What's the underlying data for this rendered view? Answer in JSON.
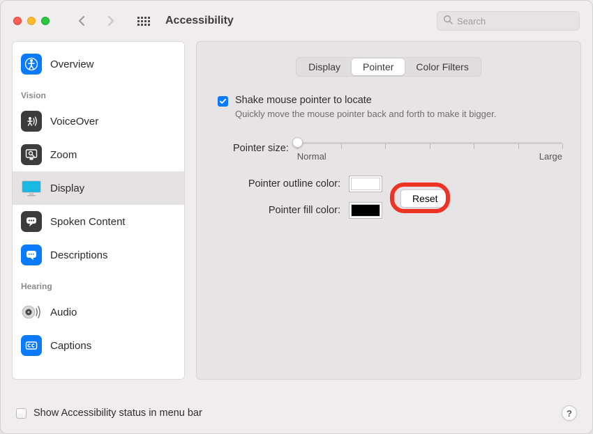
{
  "window": {
    "title": "Accessibility"
  },
  "search": {
    "placeholder": "Search"
  },
  "sidebar": {
    "sections": {
      "vision": "Vision",
      "hearing": "Hearing"
    },
    "items": {
      "overview": "Overview",
      "voiceover": "VoiceOver",
      "zoom": "Zoom",
      "display": "Display",
      "spoken": "Spoken Content",
      "descriptions": "Descriptions",
      "audio": "Audio",
      "captions": "Captions"
    }
  },
  "tabs": {
    "display": "Display",
    "pointer": "Pointer",
    "color_filters": "Color Filters"
  },
  "pointer": {
    "shake_label": "Shake mouse pointer to locate",
    "shake_sub": "Quickly move the mouse pointer back and forth to make it bigger.",
    "shake_checked": true,
    "size_label": "Pointer size:",
    "size_min_label": "Normal",
    "size_max_label": "Large",
    "size_value": 0,
    "outline_label": "Pointer outline color:",
    "outline_color": "#ffffff",
    "fill_label": "Pointer fill color:",
    "fill_color": "#000000",
    "reset_label": "Reset"
  },
  "footer": {
    "status_label": "Show Accessibility status in menu bar",
    "status_checked": false,
    "help": "?"
  }
}
